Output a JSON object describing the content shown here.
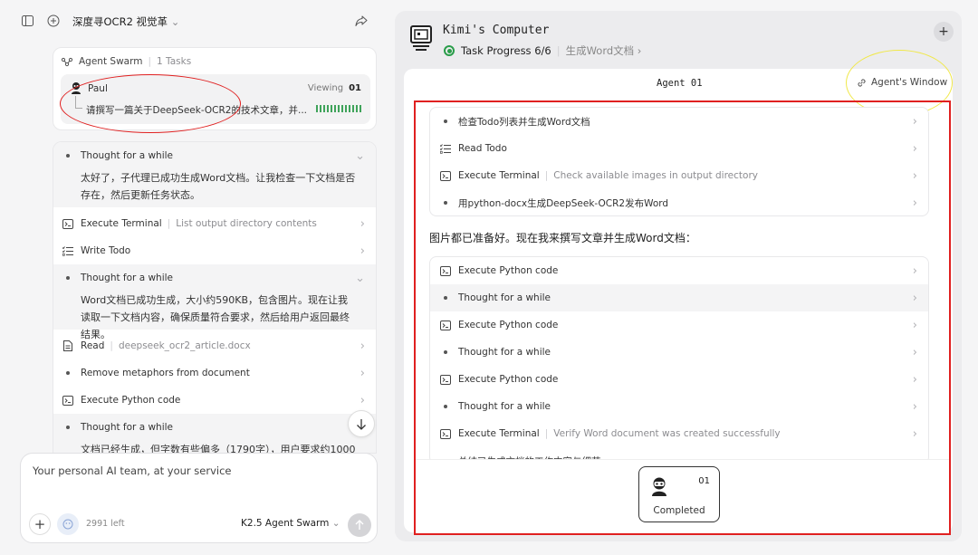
{
  "left_header": {
    "title": "深度寻OCR2 视觉革"
  },
  "swarm": {
    "label": "Agent Swarm",
    "tasks": "1 Tasks",
    "agent_name": "Paul",
    "viewing": "Viewing",
    "viewing_num": "01",
    "task_text": "请撰写一篇关于DeepSeek-OCR2的技术文章，并..."
  },
  "left_steps": [
    {
      "type": "thought",
      "label": "Thought for a while"
    },
    {
      "type": "para",
      "text": "太好了，子代理已成功生成Word文档。让我检查一下文档是否存在，然后更新任务状态。"
    },
    {
      "type": "terminal",
      "label": "Execute Terminal",
      "detail": "List output directory contents"
    },
    {
      "type": "todo",
      "label": "Write Todo"
    },
    {
      "type": "thought",
      "label": "Thought for a while"
    },
    {
      "type": "para",
      "text": "Word文档已成功生成，大小约590KB，包含图片。现在让我读取一下文档内容，确保质量符合要求，然后给用户返回最终结果。"
    },
    {
      "type": "read",
      "label": "Read",
      "detail": "deepseek_ocr2_article.docx"
    },
    {
      "type": "bullet",
      "label": "Remove metaphors from document"
    },
    {
      "type": "terminal",
      "label": "Execute Python code"
    },
    {
      "type": "thought",
      "label": "Thought for a while"
    },
    {
      "type": "para",
      "text": "文档已经生成，但字数有些偏多（1790字），用户要求约1000"
    }
  ],
  "input": {
    "placeholder": "Your personal AI team, at your service",
    "left_count": "2991 left",
    "model": "K2.5 Agent Swarm"
  },
  "right": {
    "title": "Kimi's Computer",
    "progress": "Task Progress 6/6",
    "link": "生成Word文档",
    "agent_tab": "Agent 01",
    "agent_window": "Agent's Window",
    "card1": [
      {
        "type": "bullet",
        "label": "检查Todo列表并生成Word文档"
      },
      {
        "type": "todo",
        "label": "Read Todo"
      },
      {
        "type": "terminal",
        "label": "Execute Terminal",
        "detail": "Check available images in output directory"
      },
      {
        "type": "bullet",
        "label": "用python-docx生成DeepSeek-OCR2发布Word"
      }
    ],
    "heading": "图片都已准备好。现在我来撰写文章并生成Word文档：",
    "card2": [
      {
        "type": "terminal",
        "label": "Execute Python code"
      },
      {
        "type": "bullet",
        "label": "Thought for a while",
        "shade": true
      },
      {
        "type": "terminal",
        "label": "Execute Python code"
      },
      {
        "type": "bullet",
        "label": "Thought for a while"
      },
      {
        "type": "terminal",
        "label": "Execute Python code"
      },
      {
        "type": "bullet",
        "label": "Thought for a while"
      },
      {
        "type": "terminal",
        "label": "Execute Terminal",
        "detail": "Verify Word document was created successfully"
      },
      {
        "type": "bullet",
        "label": "总结已生成文档的工作内容与细节"
      }
    ],
    "done_num": "01",
    "done_label": "Completed"
  },
  "colors": {
    "green": "#2a9d4a",
    "annotation_red": "#e02020",
    "annotation_yellow": "#f0e84a"
  }
}
